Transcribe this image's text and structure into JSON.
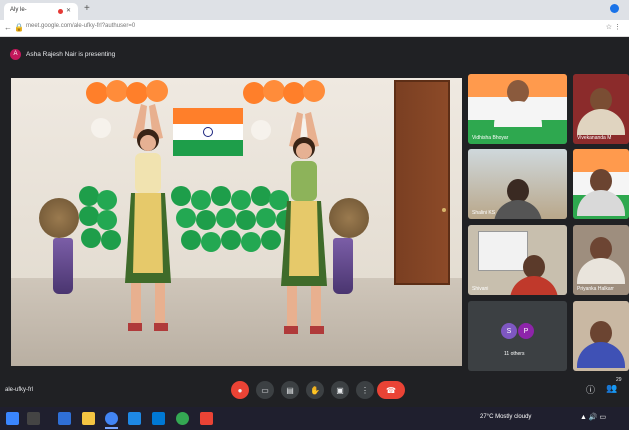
{
  "browser": {
    "tab_title": "Aly le-",
    "new_tab": "+",
    "url": "meet.google.com/ale-ufky-frl?authuser=0"
  },
  "meet": {
    "presenter_initial": "A",
    "presenter_text": "Asha Rajesh Nair is presenting",
    "meeting_code": "ale-ufky-frl",
    "participants": [
      {
        "name": "Vidhisha Bhoyar"
      },
      {
        "name": "Vivekananda M"
      },
      {
        "name": "Shalini KS"
      },
      {
        "name": ""
      },
      {
        "name": "Shivani"
      },
      {
        "name": "Priyanka Halkarr"
      },
      {
        "name": ""
      }
    ],
    "others": {
      "avatars": [
        "S",
        "P"
      ],
      "label": "11 others"
    },
    "participant_count": "29"
  },
  "controls": {
    "mic_icon": "mic-off-icon",
    "camera_icon": "camera-icon",
    "captions_icon": "captions-icon",
    "raise_hand_icon": "raise-hand-icon",
    "present_icon": "present-icon",
    "more_icon": "more-options-icon",
    "end_call_icon": "end-call-icon"
  },
  "taskbar": {
    "weather": "27°C  Mostly cloudy"
  },
  "colors": {
    "meet_bg": "#202124",
    "control_bg": "#3c4043",
    "end_call": "#ea4335",
    "saffron": "#ff7f2a",
    "green": "#1e9e4a"
  }
}
